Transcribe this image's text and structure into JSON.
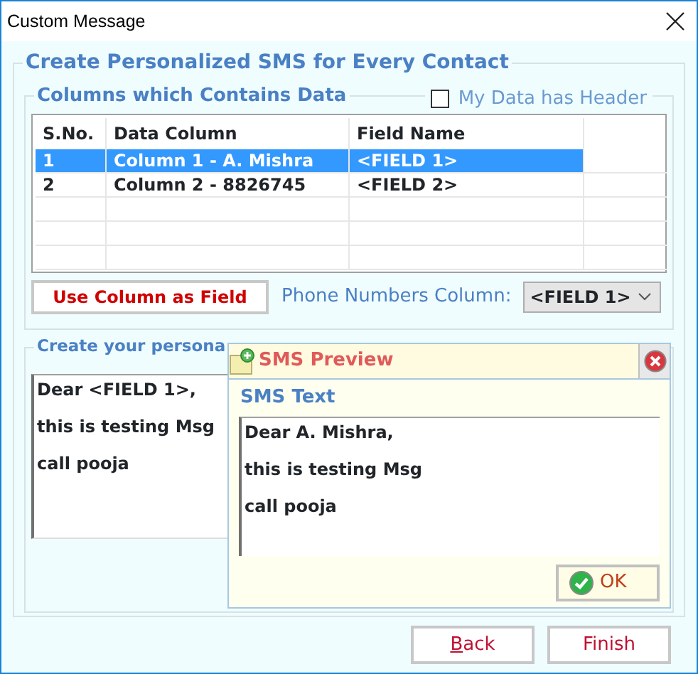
{
  "window": {
    "title": "Custom Message"
  },
  "main_group": {
    "title": "Create Personalized SMS for Every Contact"
  },
  "columns_group": {
    "title": "Columns which Contains Data",
    "header_checkbox": {
      "label": "My Data has Header",
      "checked": false
    }
  },
  "table": {
    "columns": [
      "S.No.",
      "Data Column",
      "Field Name"
    ],
    "rows": [
      {
        "cells": [
          "1",
          "Column 1 - A. Mishra",
          "<FIELD 1>"
        ],
        "selected": true
      },
      {
        "cells": [
          "2",
          "Column 2 - 8826745",
          "<FIELD 2>"
        ],
        "selected": false
      }
    ]
  },
  "use_column_button": {
    "label": "Use Column as Field"
  },
  "phone_column": {
    "label": "Phone Numbers Column:",
    "value": "<FIELD 1>"
  },
  "compose_group": {
    "title": "Create your persona",
    "lines": [
      "Dear <FIELD 1>,",
      "this is testing Msg",
      "call pooja"
    ]
  },
  "preview": {
    "title": "SMS Preview",
    "label": "SMS Text",
    "lines": [
      "Dear A. Mishra,",
      "this is testing Msg",
      "call pooja"
    ],
    "ok_button": "OK"
  },
  "buttons": [
    {
      "label": "Back",
      "underline_first": true
    },
    {
      "label": "Finish",
      "underline_first": false
    }
  ]
}
